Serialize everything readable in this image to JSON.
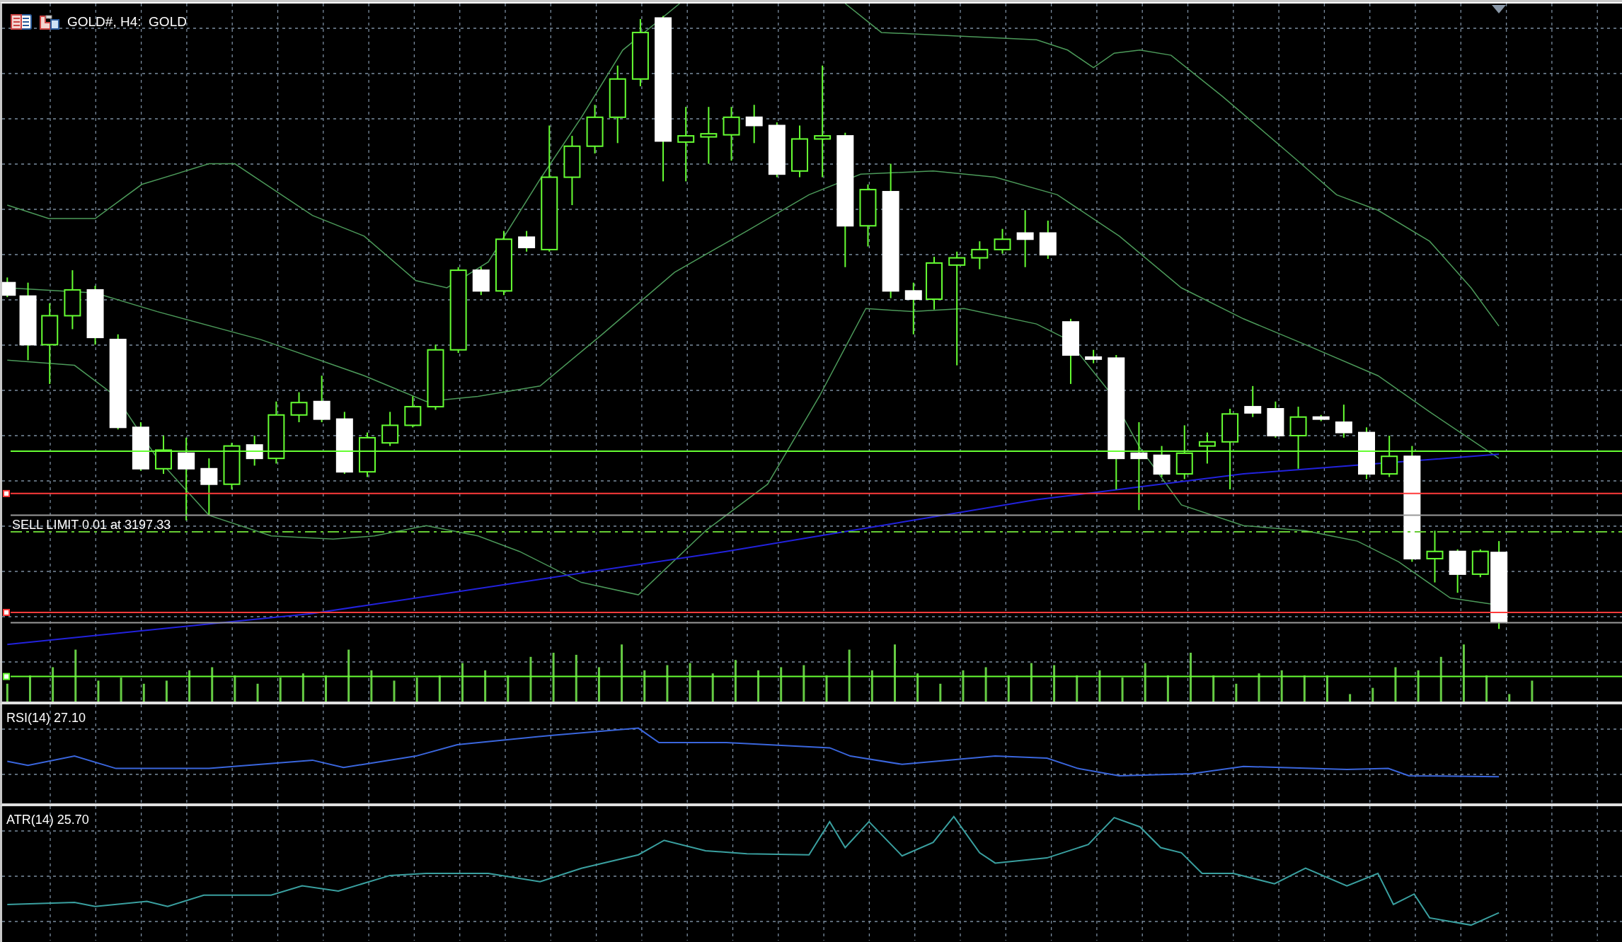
{
  "chart": {
    "title": "GOLD#, H4:  GOLD",
    "order_label": "SELL LIMIT 0.01 at 3197.33"
  },
  "indicators": [
    {
      "label": "RSI(14) 27.10"
    },
    {
      "label": "ATR(14) 25.70"
    }
  ]
}
